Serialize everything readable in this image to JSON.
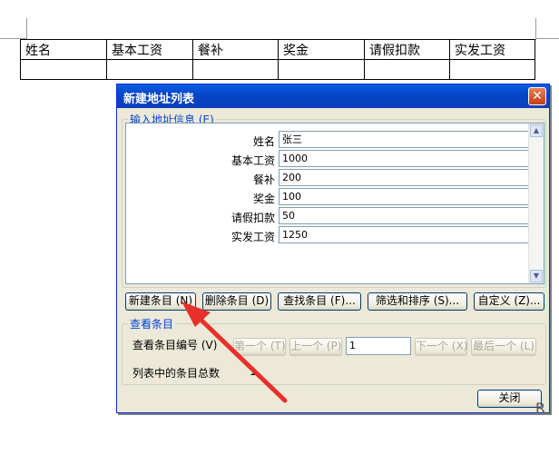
{
  "doc_table": {
    "headers": [
      "姓名",
      "基本工资",
      "餐补",
      "奖金",
      "请假扣款",
      "实发工资"
    ]
  },
  "dialog": {
    "title": "新建地址列表",
    "close_glyph": "✕",
    "input_group_label": "输入地址信息 (E)",
    "fields": [
      {
        "label": "姓名",
        "value": "张三"
      },
      {
        "label": "基本工资",
        "value": "1000"
      },
      {
        "label": "餐补",
        "value": "200"
      },
      {
        "label": "奖金",
        "value": "100"
      },
      {
        "label": "请假扣款",
        "value": "50"
      },
      {
        "label": "实发工资",
        "value": "1250"
      }
    ],
    "buttons": {
      "new_entry": "新建条目 (N)",
      "delete_entry": "删除条目 (D)",
      "find_entry": "查找条目 (F)...",
      "filter_sort": "筛选和排序 (S)...",
      "customize": "自定义 (Z)..."
    },
    "view_group_label": "查看条目",
    "view_entry_number_label": "查看条目编号 (V)",
    "nav": {
      "first": "第一个 (T)",
      "prev": "上一个 (P)",
      "current": "1",
      "next": "下一个 (X)",
      "last": "最后一个 (L)"
    },
    "total_label": "列表中的条目总数",
    "total_value": "1",
    "close_button": "关闭"
  },
  "side_mark": "R",
  "colors": {
    "title_bar": "#0446c9",
    "group_label": "#0046d5",
    "arrow": "#e8302a"
  }
}
